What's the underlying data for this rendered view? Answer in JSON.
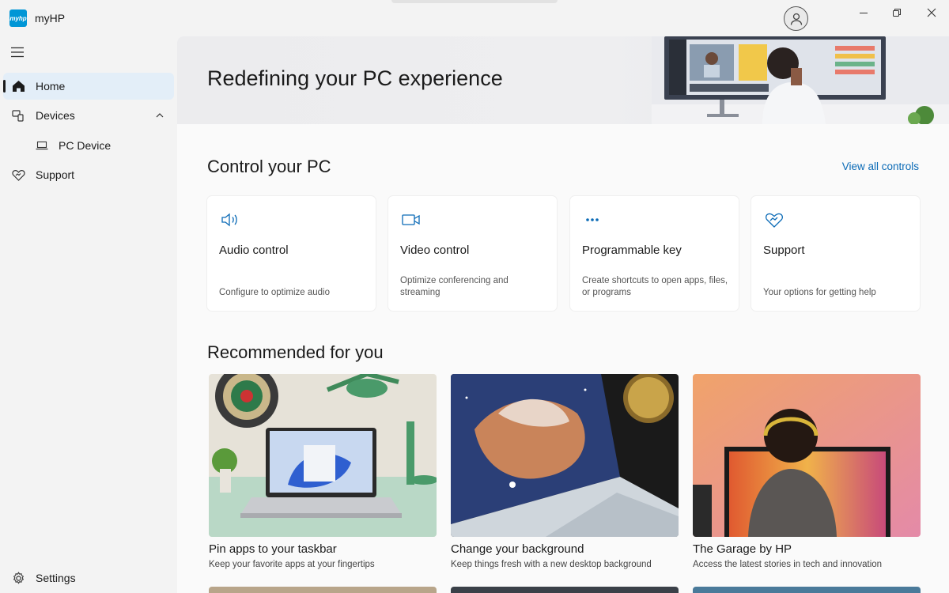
{
  "app": {
    "logo_text": "myhp",
    "title": "myHP"
  },
  "sidebar": {
    "items": [
      {
        "label": "Home",
        "icon": "home-icon",
        "active": true
      },
      {
        "label": "Devices",
        "icon": "devices-icon",
        "expanded": true
      },
      {
        "label": "PC Device",
        "icon": "laptop-icon"
      },
      {
        "label": "Support",
        "icon": "support-heart-icon"
      }
    ],
    "settings": {
      "label": "Settings",
      "icon": "gear-icon"
    }
  },
  "hero": {
    "title": "Redefining your PC experience"
  },
  "controls": {
    "title": "Control your PC",
    "view_all": "View all controls",
    "cards": [
      {
        "title": "Audio control",
        "desc": "Configure to optimize audio",
        "icon": "speaker-icon"
      },
      {
        "title": "Video control",
        "desc": "Optimize conferencing and streaming",
        "icon": "video-camera-icon"
      },
      {
        "title": "Programmable key",
        "desc": "Create shortcuts to open apps, files, or programs",
        "icon": "more-dots-icon"
      },
      {
        "title": "Support",
        "desc": "Your options for getting help",
        "icon": "support-heart-icon"
      }
    ]
  },
  "recommended": {
    "title": "Recommended for you",
    "items": [
      {
        "title": "Pin apps to your taskbar",
        "desc": "Keep your favorite apps at your fingertips"
      },
      {
        "title": "Change your background",
        "desc": "Keep things fresh with a new desktop background"
      },
      {
        "title": "The Garage by HP",
        "desc": "Access the latest stories in tech and innovation"
      }
    ]
  },
  "colors": {
    "accent": "#0096d6",
    "link": "#0a6ab6",
    "active_nav": "#e3eef8"
  }
}
